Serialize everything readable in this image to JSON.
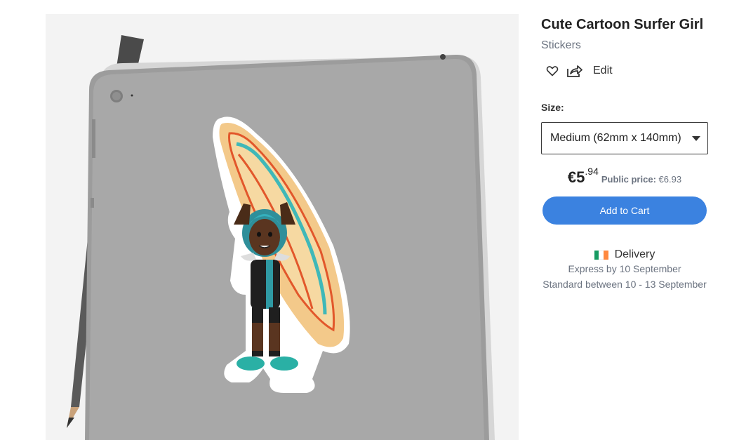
{
  "product": {
    "title": "Cute Cartoon Surfer Girl",
    "category": "Stickers",
    "edit_label": "Edit",
    "size_label": "Size:",
    "size_selected": "Medium (62mm x 140mm)",
    "price": {
      "main": "€5",
      "cents": ".94",
      "public_label": "Public price:",
      "public_value": "€6.93"
    },
    "add_to_cart_label": "Add to Cart",
    "delivery": {
      "heading": "Delivery",
      "flag_colors": [
        "#169b62",
        "#ffffff",
        "#ff883e"
      ],
      "express": "Express by 10 September",
      "standard": "Standard between 10 - 13 September"
    }
  },
  "icons": {
    "favorite": "heart-icon",
    "share": "share-icon",
    "dropdown": "caret-down-icon"
  },
  "colors": {
    "accent": "#3b82e0",
    "muted_text": "#6b7380"
  }
}
